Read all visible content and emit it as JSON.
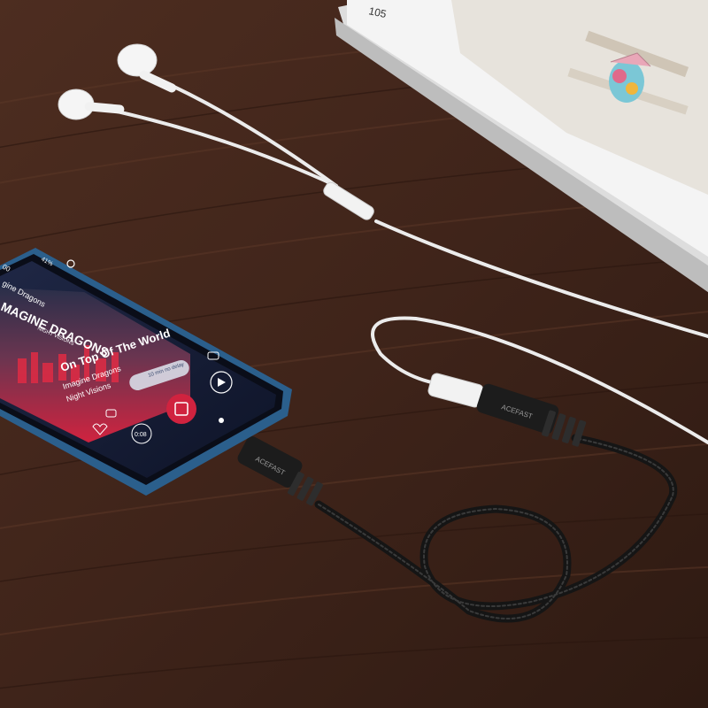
{
  "colors": {
    "desk": "#4a2b1f",
    "desk_light": "#5e3a2b",
    "phone_frame": "#2b5f8c",
    "screen_bg": "#1b2340",
    "album_red": "#d0233f",
    "cable_black": "#1a1a1a",
    "cable_white": "#eeeeee",
    "page_white": "#f4f4f4"
  },
  "book": {
    "page_number": "105"
  },
  "phone": {
    "status": {
      "time": "00",
      "battery": "41%"
    },
    "header_label": "gine Dragons",
    "album": {
      "artist_logo": "MAGINE DRAGONS",
      "album_subtitle": "NIGHT VISIONS"
    },
    "track": {
      "title": "On Top Of The World",
      "artist": "Imagine Dragons",
      "album": "Night Visions"
    },
    "controls": {
      "pill_text": "10 min no delay",
      "elapsed": "0:08"
    }
  },
  "adapter": {
    "brand": "ACEFAST"
  }
}
